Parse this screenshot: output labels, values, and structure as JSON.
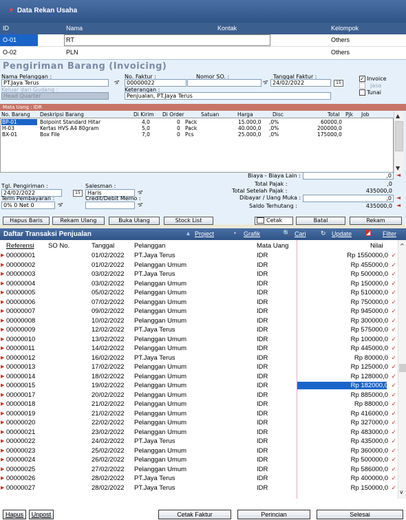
{
  "rekan": {
    "title": "Data Rekan Usaha",
    "columns": {
      "id": "ID",
      "nama": "Nama",
      "kontak": "Kontak",
      "kelompok": "Kelompok"
    },
    "rows": [
      {
        "id": "O-01",
        "nama": "RT",
        "kelompok": "Others"
      },
      {
        "id": "O-02",
        "nama": "PLN",
        "kelompok": "Others"
      }
    ]
  },
  "invoice": {
    "title": "Pengiriman Barang (Invoicing)",
    "nama_pelanggan_label": "Nama Pelanggan :",
    "nama_pelanggan": "PT.Jaya Terus",
    "keluar_gudang_label": "Keluar dari Gudang :",
    "gudang": "Head Quarter",
    "no_faktur_label": "No. Faktur :",
    "no_faktur": "00000022",
    "nomor_so_label": "Nomor SO. :",
    "tanggal_faktur_label": "Tanggal Faktur :",
    "tanggal_faktur": "24/02/2022",
    "keterangan_label": "Keterangan :",
    "keterangan": "Penjualan, PT.Jaya Terus",
    "opt_invoice": "Invoice",
    "opt_jasa": "Jasa",
    "opt_tunai": "Tunai",
    "cal_label": "15",
    "mata_uang": "Mata Uang : IDR",
    "items_columns": [
      "No. Barang",
      "Deskripsi Barang",
      "Di Kirim",
      "Di Order",
      "Satuan",
      "Harga",
      "Disc",
      "Total",
      "Pjk",
      "Job"
    ],
    "items": [
      {
        "no": "BP-01",
        "desc": "Bolpoint Standard Hitar",
        "kirim": "4,0",
        "order": "0",
        "satuan": "Pack",
        "harga": "15.000,0",
        "disc": ",0%",
        "total": "60000,0"
      },
      {
        "no": "H-03",
        "desc": "Kertas HVS A4 80gram",
        "kirim": "5,0",
        "order": "0",
        "satuan": "Pack",
        "harga": "40.000,0",
        "disc": ",0%",
        "total": "200000,0"
      },
      {
        "no": "BX-01",
        "desc": "Box File",
        "kirim": "7,0",
        "order": "0",
        "satuan": "Pcs",
        "harga": "25.000,0",
        "disc": ",0%",
        "total": "175000,0"
      }
    ],
    "biaya_lain_label": "Biaya - Biaya Lain :",
    "biaya_lain": ",0",
    "total_pajak_label": "Total Pajak :",
    "total_pajak": ",0",
    "total_setelah_pajak_label": "Total Setelah Pajak :",
    "total_setelah_pajak": "435000,0",
    "dibayar_label": "Dibayar / Uang Muka :",
    "dibayar": ",0",
    "saldo_label": "Saldo Terhutang :",
    "saldo": "435000,0",
    "tgl_pengiriman_label": "Tgl. Pengiriman :",
    "tgl_pengiriman": "24/02/2022",
    "salesman_label": "Salesman :",
    "salesman": "Haris",
    "term_label": "Term Pembayaran :",
    "term": "0% 0 Net 0",
    "credit_memo_label": "Credit/Debit Memo :",
    "btn_hapus_baris": "Hapus Baris",
    "btn_rekam_ulang": "Rekam Ulang",
    "btn_buka_ulang": "Buka Ulang",
    "btn_stock_list": "Stock List",
    "btn_cetak": "Cetak",
    "btn_batal": "Batal",
    "btn_rekam": "Rekam"
  },
  "transaksi": {
    "title": "Daftar Transaksi Penjualan",
    "toolbar": {
      "project": "Project",
      "grafik": "Grafik",
      "cari": "Cari",
      "update": "Update",
      "filter": "Filter"
    },
    "columns": {
      "ref": "Referensi",
      "so": "SO No.",
      "tanggal": "Tanggal",
      "pelanggan": "Pelanggan",
      "mata_uang": "Mata Uang",
      "nilai": "Nilai"
    },
    "rows": [
      {
        "ref": "00000001",
        "tgl": "01/02/2022",
        "pel": "PT.Jaya Terus",
        "mu": "IDR",
        "nilai": "Rp 1550000,0"
      },
      {
        "ref": "00000002",
        "tgl": "01/02/2022",
        "pel": "Pelanggan Umum",
        "mu": "IDR",
        "nilai": "Rp 455000,0"
      },
      {
        "ref": "00000003",
        "tgl": "03/02/2022",
        "pel": "PT.Jaya Terus",
        "mu": "IDR",
        "nilai": "Rp 500000,0"
      },
      {
        "ref": "00000004",
        "tgl": "03/02/2022",
        "pel": "Pelanggan Umum",
        "mu": "IDR",
        "nilai": "Rp 150000,0"
      },
      {
        "ref": "00000005",
        "tgl": "05/02/2022",
        "pel": "Pelanggan Umum",
        "mu": "IDR",
        "nilai": "Rp 510000,0"
      },
      {
        "ref": "00000006",
        "tgl": "07/02/2022",
        "pel": "Pelanggan Umum",
        "mu": "IDR",
        "nilai": "Rp 750000,0"
      },
      {
        "ref": "00000007",
        "tgl": "09/02/2022",
        "pel": "Pelanggan Umum",
        "mu": "IDR",
        "nilai": "Rp 945000,0"
      },
      {
        "ref": "00000008",
        "tgl": "10/02/2022",
        "pel": "Pelanggan Umum",
        "mu": "IDR",
        "nilai": "Rp 300000,0"
      },
      {
        "ref": "00000009",
        "tgl": "12/02/2022",
        "pel": "PT.Jaya Terus",
        "mu": "IDR",
        "nilai": "Rp 575000,0"
      },
      {
        "ref": "00000010",
        "tgl": "13/02/2022",
        "pel": "Pelanggan Umum",
        "mu": "IDR",
        "nilai": "Rp 100000,0"
      },
      {
        "ref": "00000011",
        "tgl": "14/02/2022",
        "pel": "Pelanggan Umum",
        "mu": "IDR",
        "nilai": "Rp 445000,0"
      },
      {
        "ref": "00000012",
        "tgl": "16/02/2022",
        "pel": "PT.Jaya Terus",
        "mu": "IDR",
        "nilai": "Rp 80000,0"
      },
      {
        "ref": "00000013",
        "tgl": "17/02/2022",
        "pel": "Pelanggan Umum",
        "mu": "IDR",
        "nilai": "Rp 125000,0"
      },
      {
        "ref": "00000014",
        "tgl": "18/02/2022",
        "pel": "Pelanggan Umum",
        "mu": "IDR",
        "nilai": "Rp 128000,0"
      },
      {
        "ref": "00000015",
        "tgl": "19/02/2022",
        "pel": "Pelanggan Umum",
        "mu": "IDR",
        "nilai": "Rp 182000,0",
        "selected": true
      },
      {
        "ref": "00000017",
        "tgl": "20/02/2022",
        "pel": "Pelanggan Umum",
        "mu": "IDR",
        "nilai": "Rp 885000,0"
      },
      {
        "ref": "00000018",
        "tgl": "21/02/2022",
        "pel": "Pelanggan Umum",
        "mu": "IDR",
        "nilai": "Rp 88000,0"
      },
      {
        "ref": "00000019",
        "tgl": "21/02/2022",
        "pel": "Pelanggan Umum",
        "mu": "IDR",
        "nilai": "Rp 416000,0"
      },
      {
        "ref": "00000020",
        "tgl": "22/02/2022",
        "pel": "Pelanggan Umum",
        "mu": "IDR",
        "nilai": "Rp 327000,0"
      },
      {
        "ref": "00000021",
        "tgl": "23/02/2022",
        "pel": "Pelanggan Umum",
        "mu": "IDR",
        "nilai": "Rp 483000,0"
      },
      {
        "ref": "00000022",
        "tgl": "24/02/2022",
        "pel": "PT.Jaya Terus",
        "mu": "IDR",
        "nilai": "Rp 435000,0"
      },
      {
        "ref": "00000023",
        "tgl": "25/02/2022",
        "pel": "Pelanggan Umum",
        "mu": "IDR",
        "nilai": "Rp 360000,0"
      },
      {
        "ref": "00000024",
        "tgl": "26/02/2022",
        "pel": "Pelanggan Umum",
        "mu": "IDR",
        "nilai": "Rp 500000,0"
      },
      {
        "ref": "00000025",
        "tgl": "27/02/2022",
        "pel": "Pelanggan Umum",
        "mu": "IDR",
        "nilai": "Rp 586000,0"
      },
      {
        "ref": "00000026",
        "tgl": "28/02/2022",
        "pel": "PT.Jaya Terus",
        "mu": "IDR",
        "nilai": "Rp 400000,0"
      },
      {
        "ref": "00000027",
        "tgl": "28/02/2022",
        "pel": "PT.Jaya Terus",
        "mu": "IDR",
        "nilai": "Rp 150000,0"
      }
    ]
  },
  "footer": {
    "hapus": "Hapus",
    "unpost": "Unpost",
    "cetak_faktur": "Cetak Faktur",
    "perincian": "Perincian",
    "selesai": "Selesai"
  }
}
